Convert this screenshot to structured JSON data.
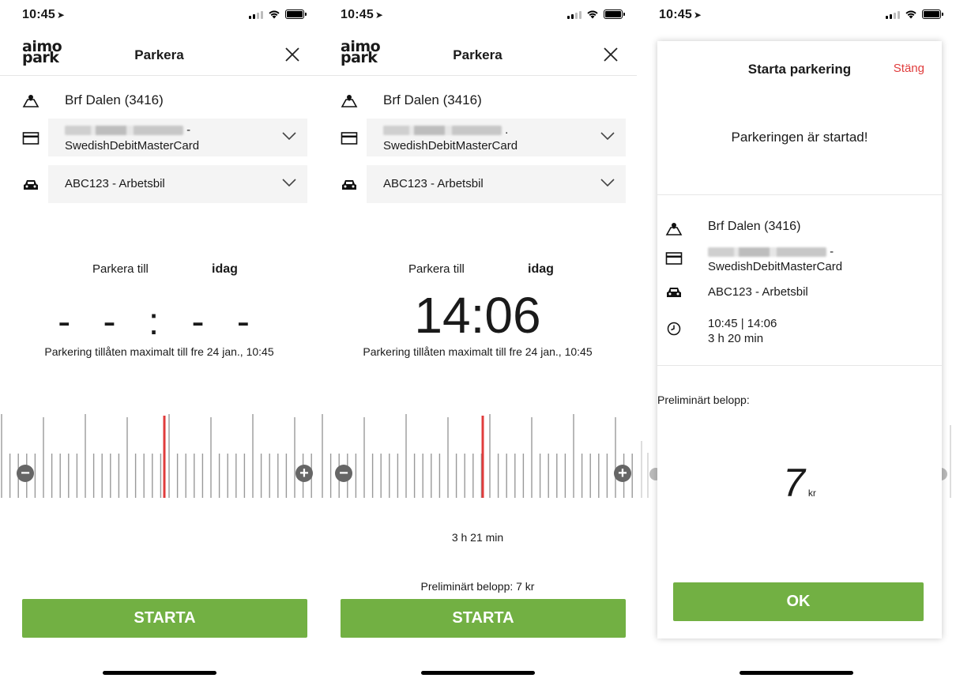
{
  "status": {
    "time": "10:45",
    "location_arrow": "➤"
  },
  "brand": {
    "logo_line1": "aimo",
    "logo_line2": "park",
    "accent": "#72b043",
    "marker": "#e03c3c"
  },
  "screen1": {
    "title": "Parkera",
    "location": "Brf Dalen (3416)",
    "card_suffix": "-",
    "card_name": "SwedishDebitMasterCard",
    "vehicle": "ABC123 - Arbetsbil",
    "park_till_label": "Parkera till",
    "park_till_day": "idag",
    "time": "- - : - -",
    "max_note": "Parkering tillåten maximalt till fre 24 jan., 10:45",
    "start_label": "STARTA"
  },
  "screen2": {
    "title": "Parkera",
    "location": "Brf Dalen (3416)",
    "card_suffix": ".",
    "card_name": "SwedishDebitMasterCard",
    "vehicle": "ABC123 - Arbetsbil",
    "park_till_label": "Parkera till",
    "park_till_day": "idag",
    "time": "14:06",
    "max_note": "Parkering tillåten maximalt till fre 24 jan., 10:45",
    "duration": "3 h 21 min",
    "estimate": "Preliminärt belopp:  7 kr",
    "start_label": "STARTA"
  },
  "screen3": {
    "title": "Starta parkering",
    "close_label": "Stäng",
    "message": "Parkeringen är startad!",
    "location": "Brf Dalen (3416)",
    "card_suffix": "-",
    "card_name": "SwedishDebitMasterCard",
    "vehicle": "ABC123 - Arbetsbil",
    "time_range": "10:45  |  14:06",
    "duration": "3 h 20 min",
    "prelim_label": "Preliminärt belopp:",
    "amount": "7",
    "amount_unit": "kr",
    "ok_label": "OK"
  },
  "icons": {
    "location": "map-pin-icon",
    "card": "credit-card-icon",
    "car": "car-icon",
    "clock": "clock-icon",
    "chevron": "chevron-down-icon",
    "close": "close-icon",
    "minus": "minus-icon",
    "plus": "plus-icon"
  }
}
